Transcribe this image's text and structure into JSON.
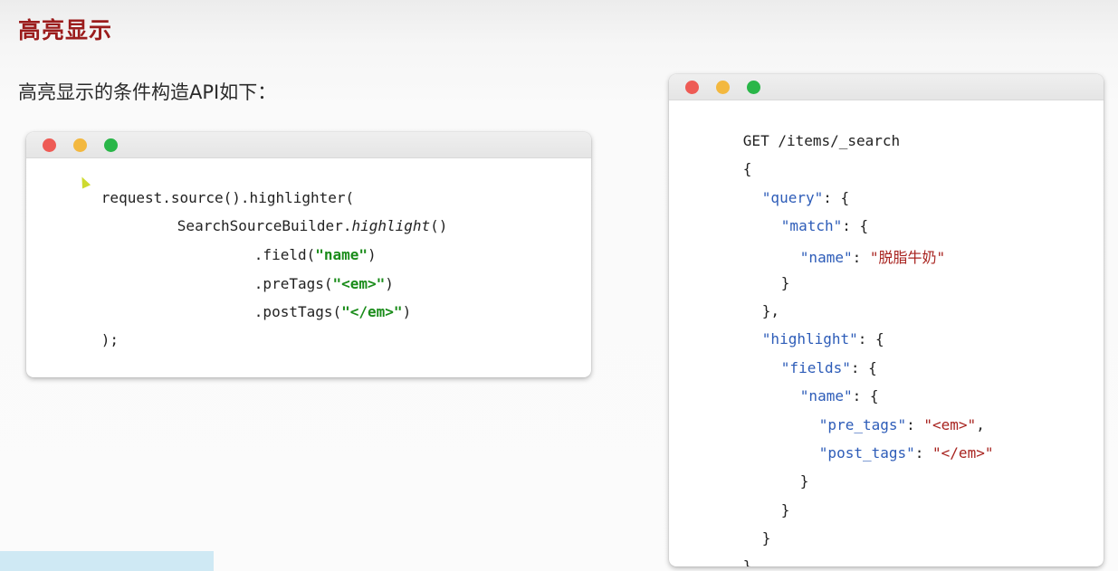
{
  "slide": {
    "title": "高亮显示",
    "intro": "高亮显示的条件构造API如下："
  },
  "left_code": {
    "line1": "request.source().highlighter(",
    "line2_prefix": "SearchSourceBuilder.",
    "line2_method": "highlight",
    "line2_suffix": "()",
    "line3_prefix": ".field(",
    "line3_arg": "\"name\"",
    "line3_suffix": ")",
    "line4_prefix": ".preTags(",
    "line4_arg": "\"<em>\"",
    "line4_suffix": ")",
    "line5_prefix": ".postTags(",
    "line5_arg": "\"</em>\"",
    "line5_suffix": ")",
    "line6": ");"
  },
  "right_code": {
    "request_line": "GET /items/_search",
    "open_brace": "{",
    "query_key": "\"query\"",
    "query_open": ": {",
    "match_key": "\"match\"",
    "match_open": ": {",
    "name_key": "\"name\"",
    "name_sep": ": ",
    "name_value": "\"脱脂牛奶\"",
    "match_close": "}",
    "query_close": "},",
    "highlight_key": "\"highlight\"",
    "highlight_open": ": {",
    "fields_key": "\"fields\"",
    "fields_open": ": {",
    "field_name_key": "\"name\"",
    "field_name_open": ": {",
    "pre_tags_key": "\"pre_tags\"",
    "pre_tags_sep": ": ",
    "pre_tags_value": "\"<em>\"",
    "pre_tags_comma": ",",
    "post_tags_key": "\"post_tags\"",
    "post_tags_sep": ": ",
    "post_tags_value": "\"</em>\"",
    "close1": "}",
    "close2": "}",
    "close3": "}",
    "close4": "}"
  },
  "colors": {
    "title": "#9b1c1c",
    "string_green": "#1a8c1a",
    "json_key": "#2d5cb8",
    "json_string": "#a8231f"
  }
}
